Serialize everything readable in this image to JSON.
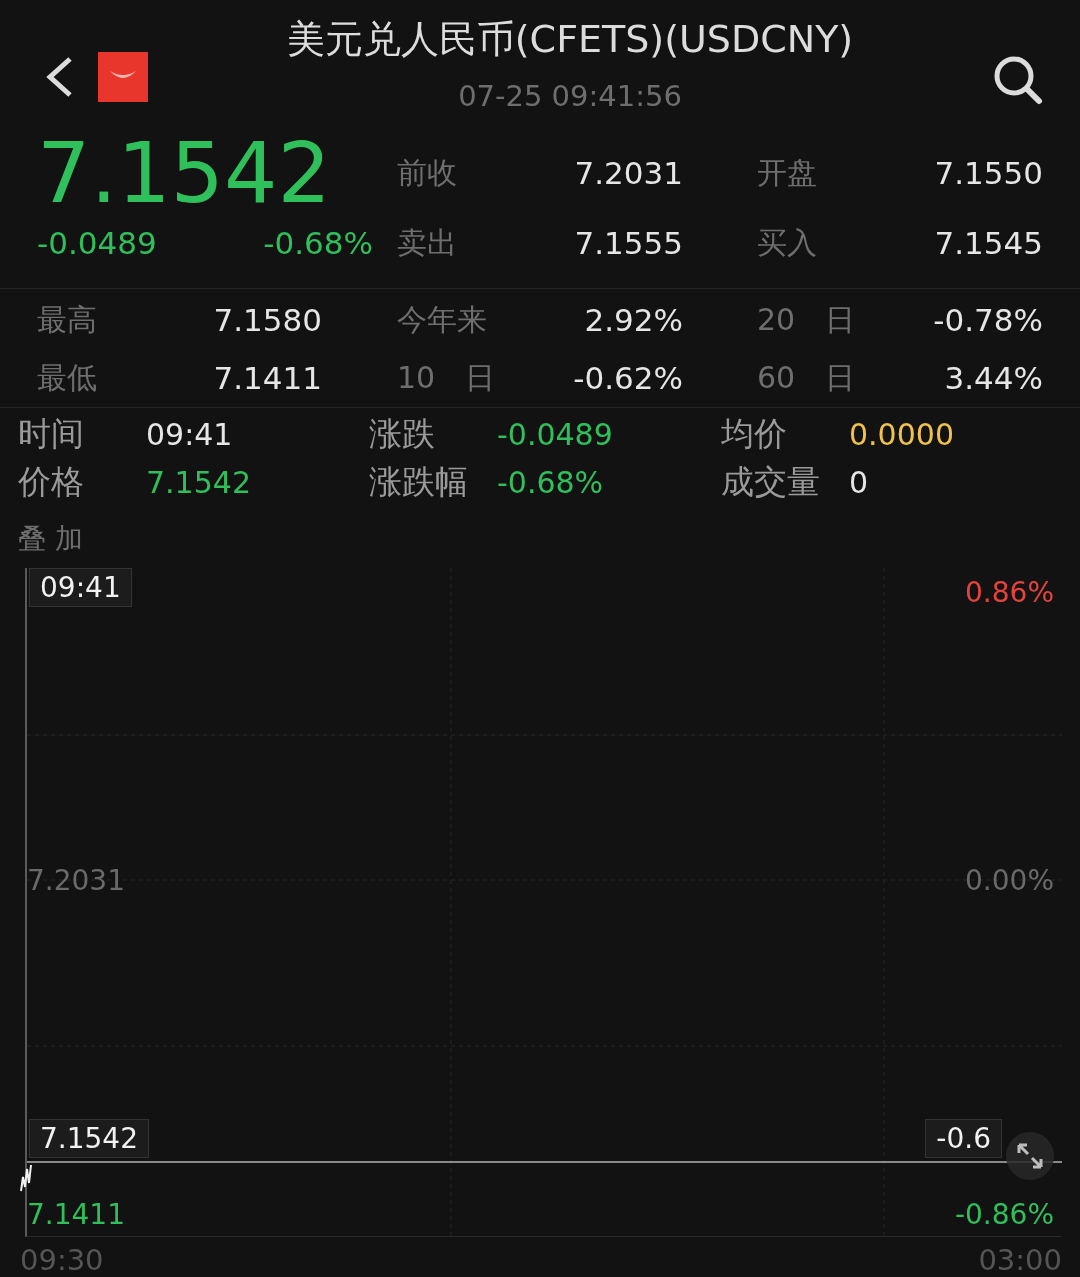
{
  "header": {
    "title": "美元兑人民币(CFETS)(USDCNY)",
    "subtitle": "07-25 09:41:56"
  },
  "quote": {
    "price": "7.1542",
    "change": "-0.0489",
    "change_pct": "-0.68%",
    "color": "#2fbf5b"
  },
  "quote_fields": [
    {
      "label": "前收",
      "value": "7.2031"
    },
    {
      "label": "开盘",
      "value": "7.1550"
    },
    {
      "label": "卖出",
      "value": "7.1555"
    },
    {
      "label": "买入",
      "value": "7.1545"
    }
  ],
  "stats": [
    {
      "label": "最高",
      "value": "7.1580"
    },
    {
      "label": "今年来",
      "value": "2.92%"
    },
    {
      "label": "20　日",
      "value": "-0.78%"
    },
    {
      "label": "最低",
      "value": "7.1411"
    },
    {
      "label": "10　日",
      "value": "-0.62%"
    },
    {
      "label": "60　日",
      "value": "3.44%"
    }
  ],
  "cursor_info": [
    {
      "label": "时间",
      "value": "09:41",
      "color": "#e6e6e6"
    },
    {
      "label": "涨跌",
      "value": "-0.0489",
      "color": "#2fbf5b"
    },
    {
      "label": "均价",
      "value": "0.0000",
      "color": "#f0c24b"
    },
    {
      "label": "价格",
      "value": "7.1542",
      "color": "#2fbf5b"
    },
    {
      "label": "涨跌幅",
      "value": "-0.68%",
      "color": "#2fbf5b"
    },
    {
      "label": "成交量",
      "value": "0",
      "color": "#e6e6e6"
    }
  ],
  "overlay_label": "叠 加",
  "chart": {
    "cursor_time": "09:41",
    "cursor_price": "7.1542",
    "cursor_pct": "-0.6",
    "left_labels": [
      {
        "text": "7.2031",
        "color": "#6a6a6a"
      },
      {
        "text": "7.1411",
        "color": "#2fbf5b"
      }
    ],
    "right_labels": [
      {
        "text": "0.86%",
        "color": "#e5433c"
      },
      {
        "text": "0.00%",
        "color": "#6a6a6a"
      },
      {
        "text": "-0.86%",
        "color": "#2fbf5b"
      }
    ],
    "x_labels": [
      "09:30",
      "03:00"
    ]
  }
}
